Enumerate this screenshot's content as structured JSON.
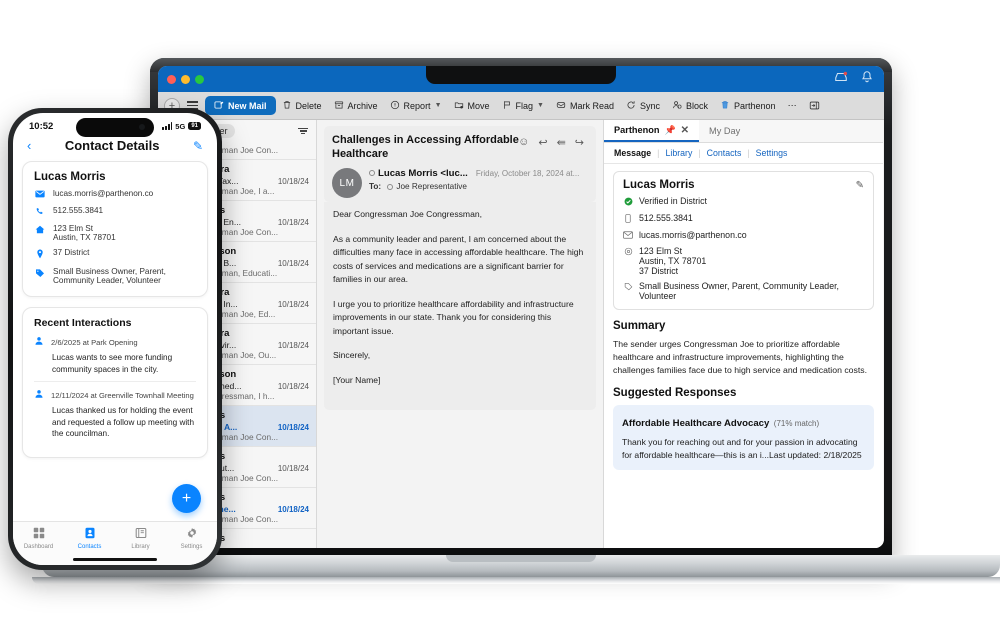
{
  "window": {
    "titlebar_icons": [
      "inbox-alert-icon",
      "bell-icon"
    ],
    "toolbar": {
      "add_label": "+",
      "menu_label": "menu",
      "items": [
        {
          "label": "New Mail",
          "icon": "compose-icon",
          "primary": true
        },
        {
          "label": "Delete",
          "icon": "trash-icon"
        },
        {
          "label": "Archive",
          "icon": "archive-box-icon"
        },
        {
          "label": "Report",
          "icon": "report-shield-icon",
          "chevron": true
        },
        {
          "label": "Move",
          "icon": "move-folder-icon"
        },
        {
          "label": "Flag",
          "icon": "flag-icon",
          "chevron": true
        },
        {
          "label": "Mark Read",
          "icon": "envelope-open-icon"
        },
        {
          "label": "Sync",
          "icon": "sync-refresh-icon"
        },
        {
          "label": "Block",
          "icon": "block-user-icon"
        },
        {
          "label": "Parthenon",
          "icon": "parthenon-trash-icon"
        },
        {
          "label": "⋯",
          "icon": "overflow-dots-icon"
        },
        {
          "label": "",
          "icon": "panel-toggle-icon"
        }
      ]
    }
  },
  "mail_list": {
    "tabs": [
      {
        "label": "ed",
        "selected": false
      },
      {
        "label": "Other",
        "selected": true
      }
    ],
    "filter_icon": "filter-icon",
    "rows": [
      {
        "from": "",
        "subject": "",
        "date": "",
        "preview": "Dear Congressman Joe Con...",
        "state": "clipped"
      },
      {
        "from": "Sophia Rivera",
        "subject": "Feedback on Tax...",
        "date": "10/18/24",
        "preview": "Dear Congressman Joe, I a...",
        "state": "read"
      },
      {
        "from": "Lucas Morris",
        "subject": "Advocating for En...",
        "date": "10/18/24",
        "preview": "Dear Congressman Joe Con...",
        "state": "read"
      },
      {
        "from": "Henry Peterson",
        "subject": "Advocating for B...",
        "date": "10/18/24",
        "preview": "Dear Congressman, Educati...",
        "state": "read"
      },
      {
        "from": "Sophia Rivera",
        "subject": "Advocating for In...",
        "date": "10/18/24",
        "preview": "Dear Congressman Joe, Ed...",
        "state": "read"
      },
      {
        "from": "Sophia Rivera",
        "subject": "Supporting Envir...",
        "date": "10/18/24",
        "preview": "Dear Congressman Joe, Ou...",
        "state": "read"
      },
      {
        "from": "Henry Peterson",
        "subject": "Request to Sched...",
        "date": "10/18/24",
        "preview": "Dear Joe Congressman, I h...",
        "state": "read"
      },
      {
        "from": "Lucas Morris",
        "subject": "Challenges in A...",
        "date": "10/18/24",
        "preview": "Dear Congressman Joe Con...",
        "state": "active"
      },
      {
        "from": "Lucas Morris",
        "subject": "Concerns About...",
        "date": "10/18/24",
        "preview": "Dear Congressman Joe Con...",
        "state": "read"
      },
      {
        "from": "Lucas Morris",
        "subject": "Addressing the...",
        "date": "10/18/24",
        "preview": "Dear Congressman Joe Con...",
        "state": "unread"
      },
      {
        "from": "Lucas Morris",
        "subject": "",
        "date": "",
        "preview": "",
        "state": "clipped"
      }
    ]
  },
  "reading_pane": {
    "subject": "Challenges in Accessing Affordable Healthcare",
    "actions": [
      "emoji-react-icon",
      "reply-icon",
      "reply-all-icon",
      "forward-icon"
    ],
    "avatar_initials": "LM",
    "sender": "Lucas Morris <luc...",
    "date": "Friday, October 18, 2024 at...",
    "to_label": "To:",
    "to_value": "Joe Representative",
    "paragraphs": [
      "Dear Congressman Joe Congressman,",
      "As a community leader and parent, I am concerned about the difficulties many face in accessing affordable healthcare. The high costs of services and medications are a significant barrier for families in our area.",
      "I urge you to prioritize healthcare affordability and infrastructure improvements in our state. Thank you for considering this important issue.",
      "Sincerely,",
      "[Your Name]"
    ]
  },
  "panel": {
    "tabs": [
      {
        "label": "Parthenon",
        "selected": true
      },
      {
        "label": "My Day",
        "selected": false
      }
    ],
    "pin_icon": "pin-icon",
    "close_icon": "close-icon",
    "subtabs": [
      {
        "label": "Message",
        "selected": true
      },
      {
        "label": "Library",
        "selected": false
      },
      {
        "label": "Contacts",
        "selected": false
      },
      {
        "label": "Settings",
        "selected": false
      }
    ],
    "contact": {
      "name": "Lucas Morris",
      "edit_icon": "pencil-edit-icon",
      "verified": "Verified in District",
      "phone": "512.555.3841",
      "email": "lucas.morris@parthenon.co",
      "address_lines": [
        "123 Elm St",
        "Austin, TX 78701",
        "37 District"
      ],
      "tags": "Small Business Owner, Parent, Community Leader, Volunteer"
    },
    "summary_title": "Summary",
    "summary_text": "The sender urges Congressman Joe to prioritize affordable healthcare and infrastructure improvements, highlighting the challenges families face due to high service and medication costs.",
    "suggested_title": "Suggested Responses",
    "suggestion": {
      "title": "Affordable Healthcare Advocacy",
      "match": "(71% match)",
      "body": "Thank you for reaching out and for your passion in advocating for affordable healthcare—this is an i...Last updated: 2/18/2025"
    }
  },
  "phone": {
    "status": {
      "time": "10:52",
      "network": "5G",
      "battery": "91",
      "signal_icon": "signal-bars-icon"
    },
    "nav": {
      "back_icon": "chevron-left-icon",
      "title": "Contact Details",
      "edit_icon": "pencil-edit-icon"
    },
    "contact": {
      "name": "Lucas Morris",
      "email": "lucas.morris@parthenon.co",
      "phone": "512.555.3841",
      "address_lines": [
        "123 Elm St",
        "Austin, TX 78701"
      ],
      "district": "37 District",
      "tags": "Small Business Owner, Parent, Community Leader, Volunteer"
    },
    "interactions_title": "Recent Interactions",
    "interactions": [
      {
        "meta": "2/6/2025 at Park Opening",
        "text": "Lucas wants to see more funding community spaces in the city."
      },
      {
        "meta": "12/11/2024 at Greenville Townhall Meeting",
        "text": "Lucas thanked us for holding the event and requested a follow up meeting with the councilman."
      }
    ],
    "fab_label": "+",
    "tabs": [
      {
        "label": "Dashboard",
        "icon": "grid-dashboard-icon",
        "selected": false
      },
      {
        "label": "Contacts",
        "icon": "contacts-card-icon",
        "selected": true
      },
      {
        "label": "Library",
        "icon": "library-book-icon",
        "selected": false
      },
      {
        "label": "Settings",
        "icon": "gear-icon",
        "selected": false
      }
    ]
  },
  "colors": {
    "accent_blue": "#0f6cbd",
    "titlebar_blue": "#0b67bd",
    "ios_blue": "#0a84ff",
    "verified_green": "#1f9c3a",
    "selected_row": "#dbe4f0",
    "suggestion_bg": "#eaf1fb"
  }
}
